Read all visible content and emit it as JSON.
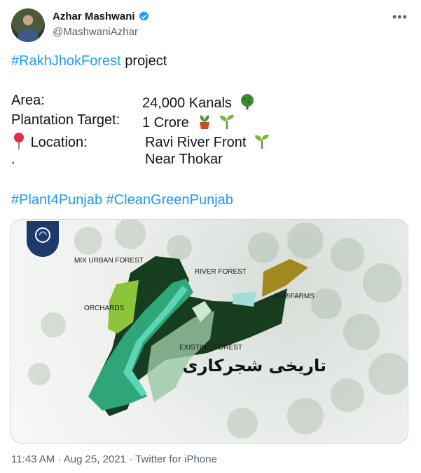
{
  "author": {
    "name": "Azhar Mashwani",
    "handle": "@MashwaniAzhar"
  },
  "tweet": {
    "line1_hashtag": "#RakhJhokForest",
    "line1_rest": " project",
    "area_label": "Area:",
    "area_value": "24,000 Kanals",
    "target_label": "Plantation Target:",
    "target_value": "1 Crore",
    "location_label": "Location:",
    "location_value": "Ravi River Front",
    "dot": ".",
    "location_value2": "Near Thokar",
    "hashtag1": "#Plant4Punjab",
    "hashtag2": "#CleanGreenPunjab"
  },
  "media": {
    "labels": {
      "mix_urban_forest": "MIX URBAN FOREST",
      "river_forest": "RIVER FOREST",
      "orchards": "ORCHARDS",
      "agrifarms": "AGRIFARMS",
      "existing_forest": "EXISTING FOREST",
      "urdu_title": "تاریخی شجرکاری"
    }
  },
  "meta": {
    "time": "11:43 AM",
    "separator": " · ",
    "date": "Aug 25, 2021",
    "source": "Twitter for iPhone"
  },
  "colors": {
    "link": "#1d9bf0",
    "muted": "#536471"
  }
}
